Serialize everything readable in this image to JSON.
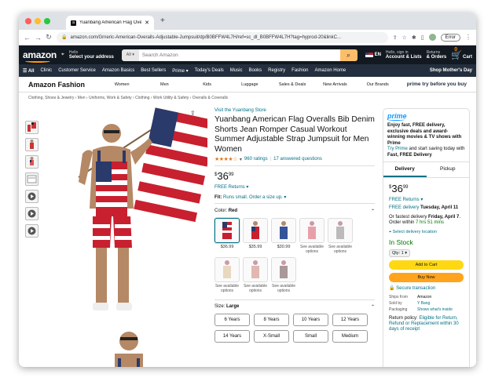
{
  "browser": {
    "tab_title": "Yuanbang American Flag Overa",
    "url": "amazon.com/Grneric-American-Overalls-Adjustable-Jumpsuit/dp/B0BFFW4L7H/ref=sc_dl_B0BFFW4L7H?tag=hyprod-20&linkC...",
    "error_label": "Error"
  },
  "header": {
    "logo": "amazon",
    "deliver_hello": "Hello",
    "deliver_label": "Select your address",
    "search_scope": "All",
    "search_placeholder": "Search Amazon",
    "lang": "EN",
    "signin_hello": "Hello, sign in",
    "account": "Account & Lists",
    "returns_top": "Returns",
    "returns": "& Orders",
    "cart_count": "0",
    "cart": "Cart"
  },
  "nav": {
    "all": "All",
    "items": [
      "Clinic",
      "Customer Service",
      "Amazon Basics",
      "Best Sellers",
      "Prime",
      "Today's Deals",
      "Music",
      "Books",
      "Registry",
      "Fashion",
      "Amazon Home"
    ],
    "promo": "Shop Mother's Day"
  },
  "fashion": {
    "title": "Amazon Fashion",
    "items": [
      "Women",
      "Men",
      "Kids",
      "Luggage",
      "Sales & Deals",
      "New Arrivals",
      "Our Brands"
    ],
    "prime_promo": "prime try before you buy"
  },
  "breadcrumb": "Clothing, Shoes & Jewelry › Men › Uniforms, Work & Safety › Clothing › Work Utility & Safety › Overalls & Coveralls",
  "product": {
    "store": "Visit the Yuanbang Store",
    "title": "Yuanbang American Flag Overalls Bib Denim Shorts Jean Romper Casual Workout Summer Adjustable Strap Jumpsuit for Men Women",
    "stars": "★★★★☆",
    "ratings": "960 ratings",
    "answered": "17 answered questions",
    "price_cur": "$",
    "price_whole": "36",
    "price_frac": "99",
    "free_returns": "FREE Returns",
    "fit_label": "Fit:",
    "fit_text": "Runs small. Order a size up.",
    "color_label": "Color:",
    "color_value": "Red",
    "size_label": "Size:",
    "size_value": "Large"
  },
  "swatches": [
    {
      "label": "$36.99"
    },
    {
      "label": "$35.99"
    },
    {
      "label": "$30.99"
    },
    {
      "label": "See available options"
    },
    {
      "label": "See available options"
    },
    {
      "label": "See available options"
    },
    {
      "label": "See available options"
    },
    {
      "label": "See available options"
    }
  ],
  "sizes": [
    "6 Years",
    "8 Years",
    "10 Years",
    "12 Years",
    "14 Years",
    "X-Small",
    "Small",
    "Medium"
  ],
  "buybox": {
    "prime_text": "Enjoy fast, FREE delivery, exclusive deals and award-winning movies & TV shows with Prime",
    "try_prime": "Try Prime",
    "try_prime_rest": "and start saving today with",
    "fast_free": "Fast, FREE Delivery",
    "tab_delivery": "Delivery",
    "tab_pickup": "Pickup",
    "free_returns": "FREE Returns",
    "free_delivery": "FREE delivery",
    "delivery_date": "Tuesday, April 11",
    "fastest": "Or fastest delivery",
    "fastest_date": "Friday, April 7",
    "order_within": "Order within",
    "within_time": "7 hrs 51 mins",
    "select_location": "Select delivery location",
    "in_stock": "In Stock",
    "qty": "Qty: 1",
    "add_to_cart": "Add to Cart",
    "buy_now": "Buy Now",
    "secure": "Secure transaction",
    "ships_from_k": "Ships from",
    "ships_from_v": "Amazon",
    "sold_by_k": "Sold by",
    "sold_by_v": "Y Bang",
    "packaging_k": "Packaging",
    "packaging_v": "Shows what's inside",
    "return_policy": "Return policy:",
    "return_link": "Eligible for Return, Refund or Replacement within 30 days of receipt"
  }
}
